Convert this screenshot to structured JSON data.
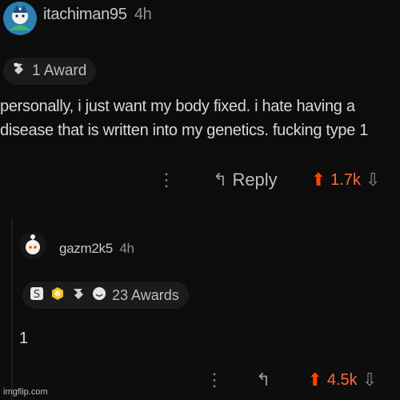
{
  "comment1": {
    "username": "itachiman95",
    "time": "4h",
    "awards_label": "1 Award",
    "body_line1": "personally, i just want my body fixed. i hate having a",
    "body_line2": "disease that is written into my genetics. fucking type 1",
    "reply_label": "Reply",
    "score": "1.7k",
    "vote_state": "upvoted"
  },
  "comment2": {
    "username": "gazm2k5",
    "time": "4h",
    "awards_label": "23 Awards",
    "body": "1",
    "score": "4.5k",
    "vote_state": "upvoted"
  },
  "icons": {
    "more": "more-dots-icon",
    "reply": "reply-arrow-icon",
    "upvote": "upvote-arrow-icon",
    "downvote": "downvote-arrow-icon"
  },
  "colors": {
    "upvote": "#ff4500",
    "background": "#0b0b0b"
  },
  "watermark": "imgflip.com"
}
